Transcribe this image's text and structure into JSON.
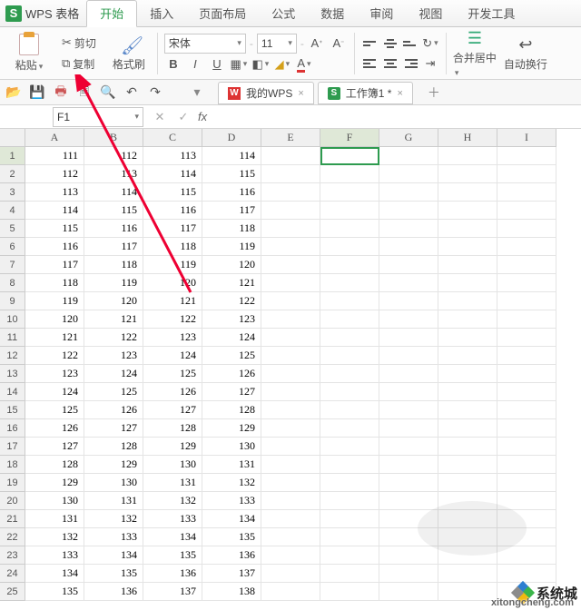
{
  "app": {
    "logo_letter": "S",
    "name": "WPS 表格"
  },
  "tabs": [
    "开始",
    "插入",
    "页面布局",
    "公式",
    "数据",
    "审阅",
    "视图",
    "开发工具"
  ],
  "active_tab_index": 0,
  "ribbon": {
    "paste": "粘贴",
    "cut": "剪切",
    "copy": "复制",
    "format_painter": "格式刷",
    "font_name": "宋体",
    "font_size": "11",
    "merge_center": "合并居中",
    "wrap_text": "自动换行"
  },
  "doc_tabs": [
    {
      "icon": "wps",
      "label": "我的WPS"
    },
    {
      "icon": "xls",
      "label": "工作簿1 *"
    }
  ],
  "namebox": "F1",
  "columns": [
    "A",
    "B",
    "C",
    "D",
    "E",
    "F",
    "G",
    "H",
    "I"
  ],
  "row_count": 25,
  "selected_cell": {
    "row": 1,
    "col": "F"
  },
  "chart_data": {
    "type": "table",
    "columns": [
      "A",
      "B",
      "C",
      "D"
    ],
    "rows": [
      [
        111,
        112,
        113,
        114
      ],
      [
        112,
        113,
        114,
        115
      ],
      [
        113,
        114,
        115,
        116
      ],
      [
        114,
        115,
        116,
        117
      ],
      [
        115,
        116,
        117,
        118
      ],
      [
        116,
        117,
        118,
        119
      ],
      [
        117,
        118,
        119,
        120
      ],
      [
        118,
        119,
        120,
        121
      ],
      [
        119,
        120,
        121,
        122
      ],
      [
        120,
        121,
        122,
        123
      ],
      [
        121,
        122,
        123,
        124
      ],
      [
        122,
        123,
        124,
        125
      ],
      [
        123,
        124,
        125,
        126
      ],
      [
        124,
        125,
        126,
        127
      ],
      [
        125,
        126,
        127,
        128
      ],
      [
        126,
        127,
        128,
        129
      ],
      [
        127,
        128,
        129,
        130
      ],
      [
        128,
        129,
        130,
        131
      ],
      [
        129,
        130,
        131,
        132
      ],
      [
        130,
        131,
        132,
        133
      ],
      [
        131,
        132,
        133,
        134
      ],
      [
        132,
        133,
        134,
        135
      ],
      [
        133,
        134,
        135,
        136
      ],
      [
        134,
        135,
        136,
        137
      ],
      [
        135,
        136,
        137,
        138
      ]
    ]
  },
  "watermark": {
    "brand": "系统城",
    "url": "xitongcheng.com"
  }
}
